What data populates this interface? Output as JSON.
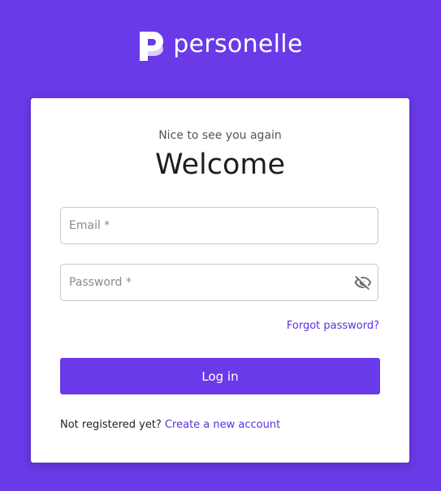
{
  "brand": {
    "name": "personelle",
    "logo_icon": "personelle-p-logo-icon"
  },
  "login": {
    "subtitle": "Nice to see you again",
    "title": "Welcome",
    "email": {
      "placeholder": "Email *",
      "value": ""
    },
    "password": {
      "placeholder": "Password *",
      "value": "",
      "toggle_icon": "eye-off-icon"
    },
    "forgot_label": "Forgot password?",
    "login_label": "Log in",
    "register_prompt": "Not registered yet?",
    "register_link": "Create a new account"
  },
  "colors": {
    "background": "#6a3ae8",
    "accent": "#6a3ae8",
    "link": "#5b2fd9",
    "card": "#ffffff"
  }
}
